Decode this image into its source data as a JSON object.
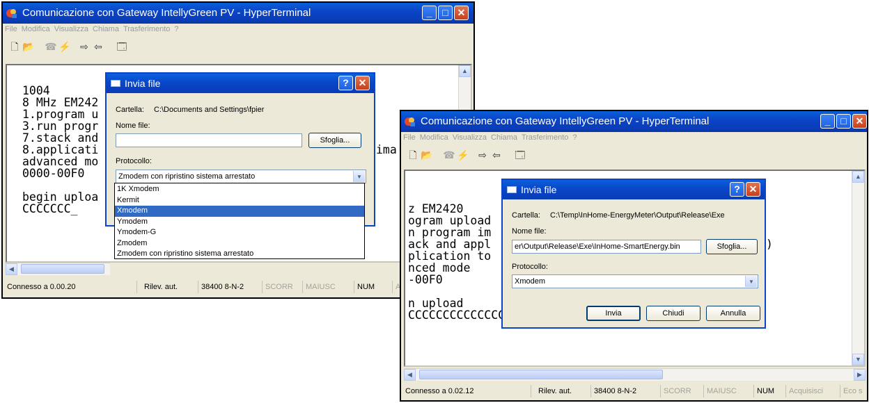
{
  "win1": {
    "title": "Comunicazione con Gateway IntellyGreen PV - HyperTerminal",
    "menu": [
      "File",
      "Modifica",
      "Visualizza",
      "Chiama",
      "Trasferimento",
      "?"
    ],
    "terminal_lines": [
      "1004",
      "8 MHz EM242",
      "1.program u",
      "3.run progr",
      "7.stack and",
      "8.applicati",
      "advanced mo",
      "0000-00F0",
      "",
      "begin uploa",
      "CCCCCCC_"
    ],
    "terminal_tail": "ima",
    "status": {
      "connection": "Connesso a 0.00.20",
      "detect": "Rilev. aut.",
      "baud": "38400 8-N-2",
      "scroll": "SCORR",
      "caps": "MAIUSC",
      "num": "NUM",
      "capture_partial": "A"
    },
    "dialog": {
      "title": "Invia file",
      "folder_label": "Cartella:",
      "folder_value": "C:\\Documents and Settings\\fpier",
      "filename_label": "Nome file:",
      "filename_value": "",
      "browse": "Sfoglia...",
      "protocol_label": "Protocollo:",
      "protocol_selected": "Zmodem con ripristino sistema arrestato",
      "protocol_options": [
        "1K Xmodem",
        "Kermit",
        "Xmodem",
        "Ymodem",
        "Ymodem-G",
        "Zmodem",
        "Zmodem con ripristino sistema arrestato"
      ],
      "highlighted_option": "Xmodem"
    }
  },
  "win2": {
    "title": "Comunicazione con Gateway IntellyGreen PV - HyperTerminal",
    "menu": [
      "File",
      "Modifica",
      "Visualizza",
      "Chiama",
      "Trasferimento",
      "?"
    ],
    "terminal_lines": [
      "",
      "",
      "z EM2420",
      "ogram upload",
      "n program im",
      "ack and appl",
      "plication to",
      "nced mode",
      "-00F0",
      "",
      "n upload",
      "CCCCCCCCCCCCCCCCCCCCCCCCCCCCCCCCCCCCCCCCCCCCCC:_"
    ],
    "terminal_tail": ")",
    "status": {
      "connection": "Connesso a 0.02.12",
      "detect": "Rilev. aut.",
      "baud": "38400 8-N-2",
      "scroll": "SCORR",
      "caps": "MAIUSC",
      "num": "NUM",
      "capture": "Acquisisci",
      "echo_partial": "Eco s"
    },
    "dialog": {
      "title": "Invia file",
      "folder_label": "Cartella:",
      "folder_value": "C:\\Temp\\InHome-EnergyMeter\\Output\\Release\\Exe",
      "filename_label": "Nome file:",
      "filename_value": "er\\Output\\Release\\Exe\\InHome-SmartEnergy.bin",
      "browse": "Sfoglia...",
      "protocol_label": "Protocollo:",
      "protocol_selected": "Xmodem",
      "send": "Invia",
      "close": "Chiudi",
      "cancel": "Annulla"
    }
  },
  "colors": {
    "titlebar": "#0a46c8",
    "window_bg": "#ece9d8",
    "close_button": "#d4502a",
    "selection": "#316ac5"
  }
}
